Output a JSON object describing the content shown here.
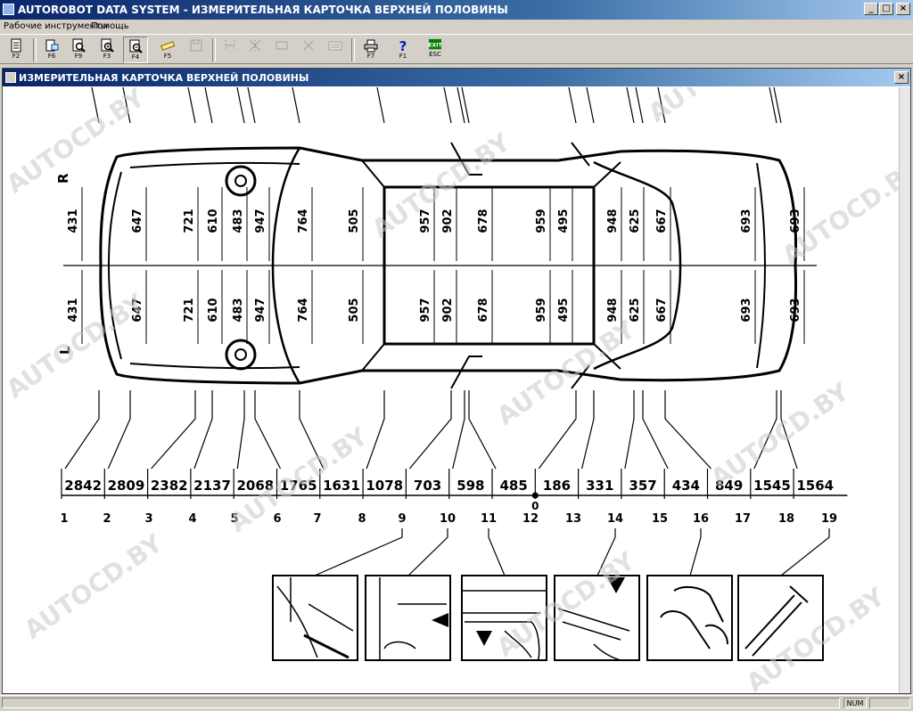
{
  "window": {
    "title": "AUTOROBOT DATA SYSTEM - ИЗМЕРИТЕЛЬНАЯ КАРТОЧКА ВЕРХНЕЙ ПОЛОВИНЫ"
  },
  "menu": {
    "items": [
      "Рабочие инструменты",
      "Помощь"
    ]
  },
  "toolbar": {
    "buttons": [
      {
        "key": "F2",
        "icon": "document-icon"
      },
      {
        "key": "F6",
        "icon": "print-preview-icon"
      },
      {
        "key": "F9",
        "icon": "magnifier-icon"
      },
      {
        "key": "F3",
        "icon": "zoom-in-icon"
      },
      {
        "key": "F4",
        "icon": "zoom-out-icon"
      },
      {
        "key": "F5",
        "icon": "ruler-icon"
      },
      {
        "key": "",
        "icon": "save-icon"
      },
      {
        "key": "",
        "icon": "measure-points-icon"
      },
      {
        "key": "",
        "icon": "measure-frame-icon"
      },
      {
        "key": "",
        "icon": "cross-measure-icon"
      },
      {
        "key": "",
        "icon": "keyboard-icon"
      },
      {
        "key": "F7",
        "icon": "printer-icon"
      },
      {
        "key": "F1",
        "icon": "help-icon"
      },
      {
        "key": "ESC",
        "icon": "exit-icon"
      }
    ],
    "exit_label": "EXIT"
  },
  "document": {
    "title": "ИЗМЕРИТЕЛЬНАЯ КАРТОЧКА ВЕРХНЕЙ ПОЛОВИНЫ",
    "side_right": "R",
    "side_left": "L"
  },
  "chart_data": {
    "type": "table",
    "width_labels": [
      "431",
      "647",
      "721",
      "610",
      "483",
      "947",
      "764",
      "505",
      "957",
      "902",
      "678",
      "959",
      "495",
      "948",
      "625",
      "667",
      "693",
      "693"
    ],
    "length_dims": [
      "2842",
      "2809",
      "2382",
      "2137",
      "2068",
      "1765",
      "1631",
      "1078",
      "703",
      "598",
      "485",
      "186",
      "331",
      "357",
      "434",
      "849",
      "1545",
      "1564"
    ],
    "point_numbers": [
      "1",
      "2",
      "3",
      "4",
      "5",
      "6",
      "7",
      "8",
      "9",
      "10",
      "11",
      "12",
      "13",
      "14",
      "15",
      "16",
      "17",
      "18",
      "19"
    ],
    "zero_label": "0"
  },
  "watermark": "AUTOCD.BY",
  "status": {
    "num": "NUM"
  }
}
